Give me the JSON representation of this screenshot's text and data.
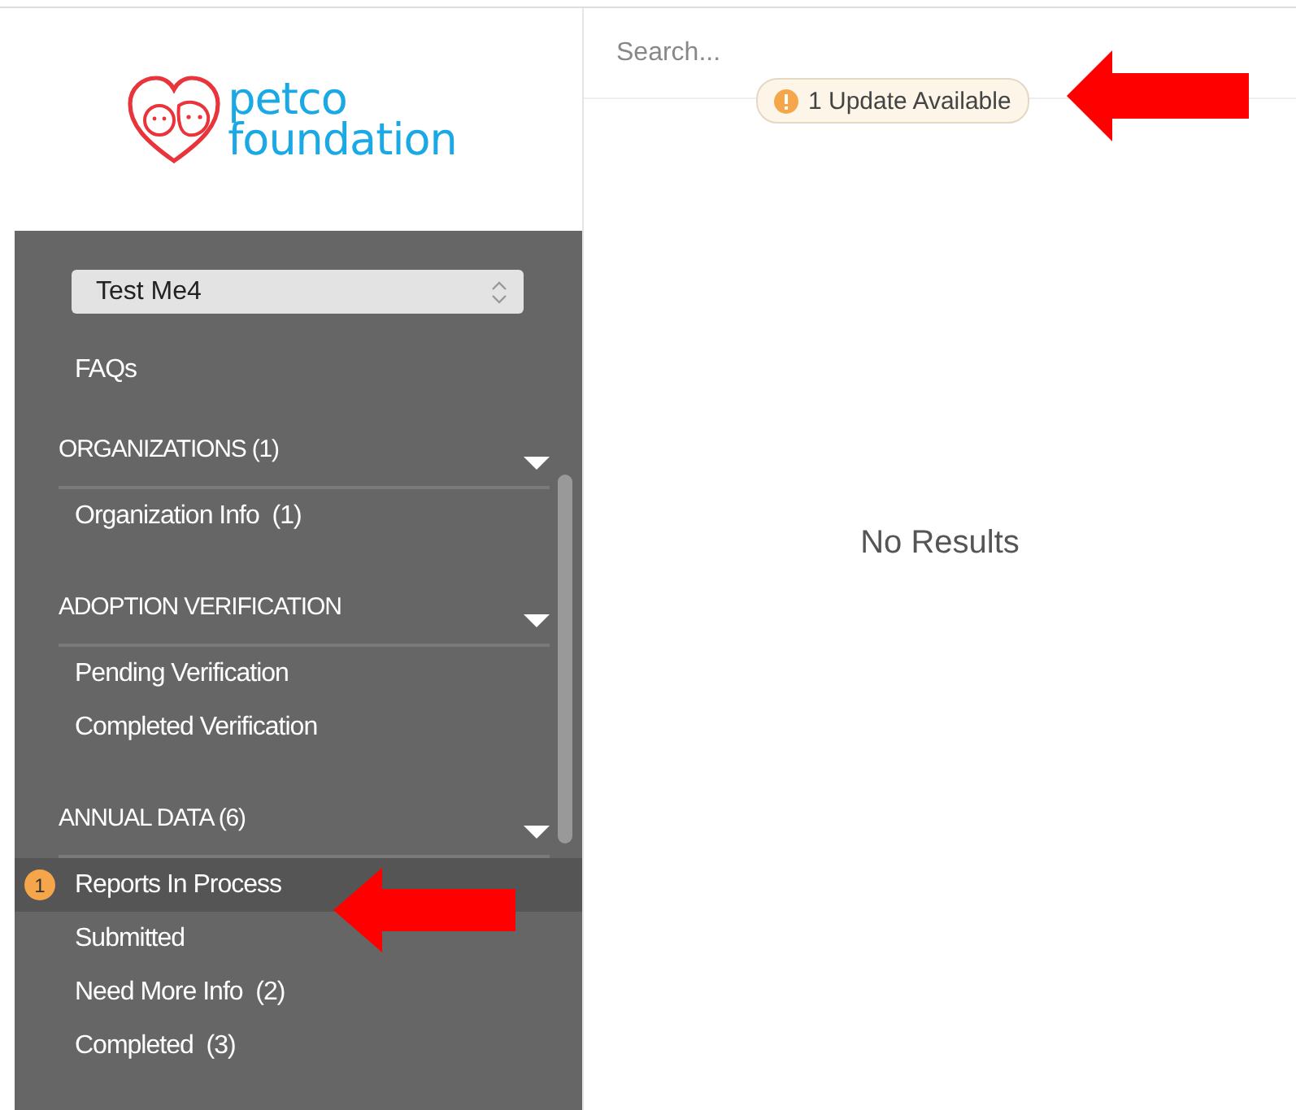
{
  "logo": {
    "line_1": "petco",
    "line_2": "foundation"
  },
  "account_select": {
    "value": "Test Me4"
  },
  "faqs_link": "FAQs",
  "sections": [
    {
      "title": "ORGANIZATIONS (1)",
      "expanded": true,
      "items": [
        {
          "label": "Organization Info  (1)",
          "selected": false
        }
      ]
    },
    {
      "title": "ADOPTION VERIFICATION",
      "expanded": true,
      "items": [
        {
          "label": "Pending Verification",
          "selected": false
        },
        {
          "label": "Completed Verification",
          "selected": false
        }
      ]
    },
    {
      "title": "ANNUAL DATA (6)",
      "expanded": true,
      "items": [
        {
          "label": "Reports In Process",
          "selected": true,
          "badge": "1"
        },
        {
          "label": "Submitted",
          "selected": false
        },
        {
          "label": "Need More Info  (2)",
          "selected": false
        },
        {
          "label": "Completed  (3)",
          "selected": false
        }
      ]
    }
  ],
  "search": {
    "placeholder": "Search..."
  },
  "update_badge": {
    "text": "1 Update Available"
  },
  "empty_message": "No Results"
}
